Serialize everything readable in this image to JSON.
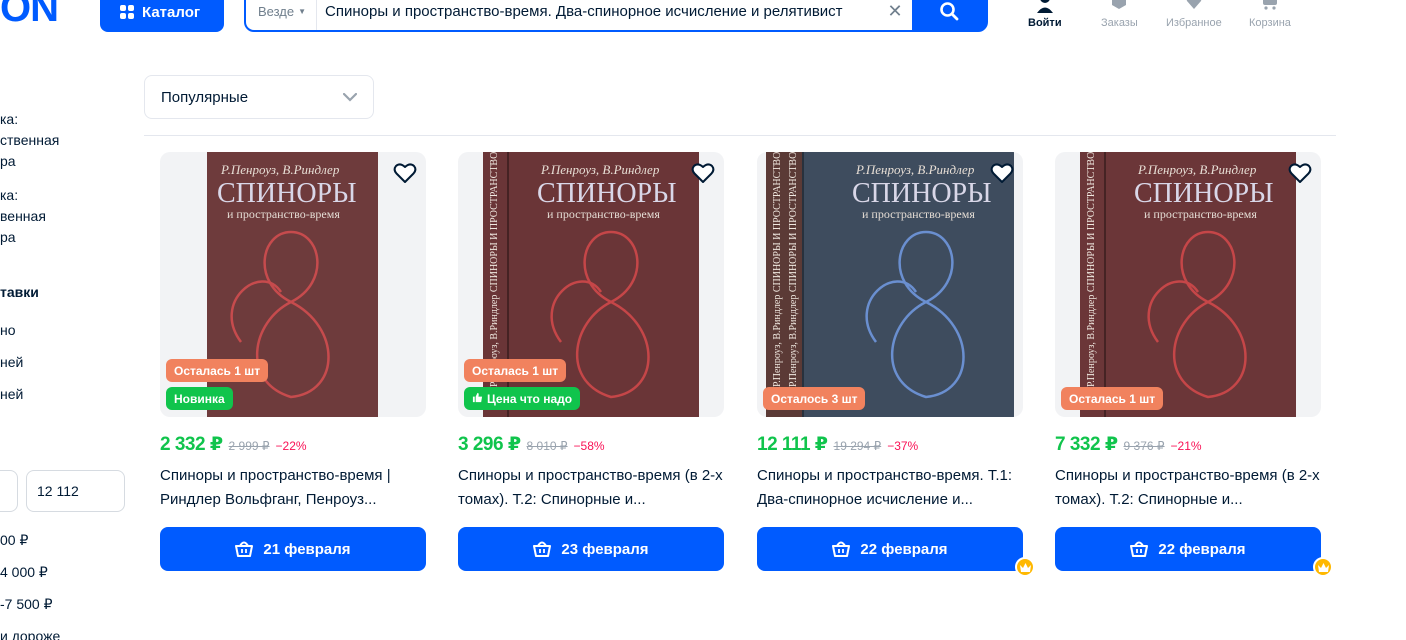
{
  "header": {
    "logo": "ON",
    "catalog_label": "Каталог",
    "search_scope": "Везде",
    "search_value": "Спиноры и пространство-время. Два-спинорное исчисление и релятивист",
    "nav": [
      {
        "label": "Войти",
        "icon": "user-icon"
      },
      {
        "label": "Заказы",
        "icon": "box-icon"
      },
      {
        "label": "Избранное",
        "icon": "heart-icon"
      },
      {
        "label": "Корзина",
        "icon": "cart-icon"
      }
    ]
  },
  "sidebar": {
    "lines": [
      "ка:",
      "ственная",
      "ра",
      "ка:",
      "венная",
      "ра"
    ],
    "delivery_heading": "тавки",
    "delivery_options": [
      "но",
      "ней",
      "ней"
    ],
    "price_from": "",
    "price_to": "12 112",
    "price_ranges": [
      "00 ₽",
      "4 000 ₽",
      "-7 500 ₽",
      " и дороже"
    ]
  },
  "sort": {
    "selected": "Популярные"
  },
  "products": [
    {
      "price": "2 332 ₽",
      "old_price": "2 999 ₽",
      "discount": "−22%",
      "title": "Спиноры и пространство-время | Риндлер Вольфганг, Пенроуз...",
      "badges": [
        {
          "text": "Осталась 1 шт",
          "kind": "orange"
        },
        {
          "text": "Новинка",
          "kind": "green"
        }
      ],
      "delivery": "21 февраля",
      "premium": false,
      "cover": {
        "author": "Р.Пенроуз, В.Риндлер",
        "title": "СПИНОРЫ",
        "subtitle": "и пространство-время",
        "spine": ""
      }
    },
    {
      "price": "3 296 ₽",
      "old_price": "8 010 ₽",
      "discount": "−58%",
      "title": "Спиноры и пространство-время (в 2-х томах). Т.2: Спинорные и...",
      "badges": [
        {
          "text": "Осталась 1 шт",
          "kind": "orange"
        },
        {
          "text": "Цена что надо",
          "kind": "green"
        }
      ],
      "delivery": "23 февраля",
      "premium": false,
      "cover": {
        "author": "Р.Пенроуз, В.Риндлер",
        "title": "СПИНОРЫ",
        "subtitle": "и пространство-время",
        "spine": "Р.Пенроуз, В.Риндлер  СПИНОРЫ И ПРОСТРАНСТВО-ВРЕМЯ"
      }
    },
    {
      "price": "12 111 ₽",
      "old_price": "19 294 ₽",
      "discount": "−37%",
      "title": "Спиноры и пространство-время. Т.1: Два-спинорное исчисление и...",
      "badges": [
        {
          "text": "Осталось 3 шт",
          "kind": "orange"
        }
      ],
      "delivery": "22 февраля",
      "premium": true,
      "cover": {
        "author": "Р.Пенроуз, В.Риндлер",
        "title": "СПИНОРЫ",
        "subtitle": "и пространство-время",
        "spine": "Р.Пенроуз, В.Риндлер  СПИНОРЫ И ПРОСТРАНСТВО-ВРЕМЯ"
      }
    },
    {
      "price": "7 332 ₽",
      "old_price": "9 376 ₽",
      "discount": "−21%",
      "title": "Спиноры и пространство-время (в 2-х томах). Т.2: Спинорные и...",
      "badges": [
        {
          "text": "Осталась 1 шт",
          "kind": "orange"
        }
      ],
      "delivery": "22 февраля",
      "premium": true,
      "cover": {
        "author": "Р.Пенроуз, В.Риндлер",
        "title": "СПИНОРЫ",
        "subtitle": "и пространство-время",
        "spine": "Р.Пенроуз, В.Риндлер  СПИНОРЫ И ПРОСТРАНСТВО-ВРЕМЯ"
      }
    }
  ],
  "colors": {
    "brand": "#005bff",
    "price_green": "#10c44c",
    "discount_red": "#f91155",
    "badge_orange": "#f1825e"
  }
}
